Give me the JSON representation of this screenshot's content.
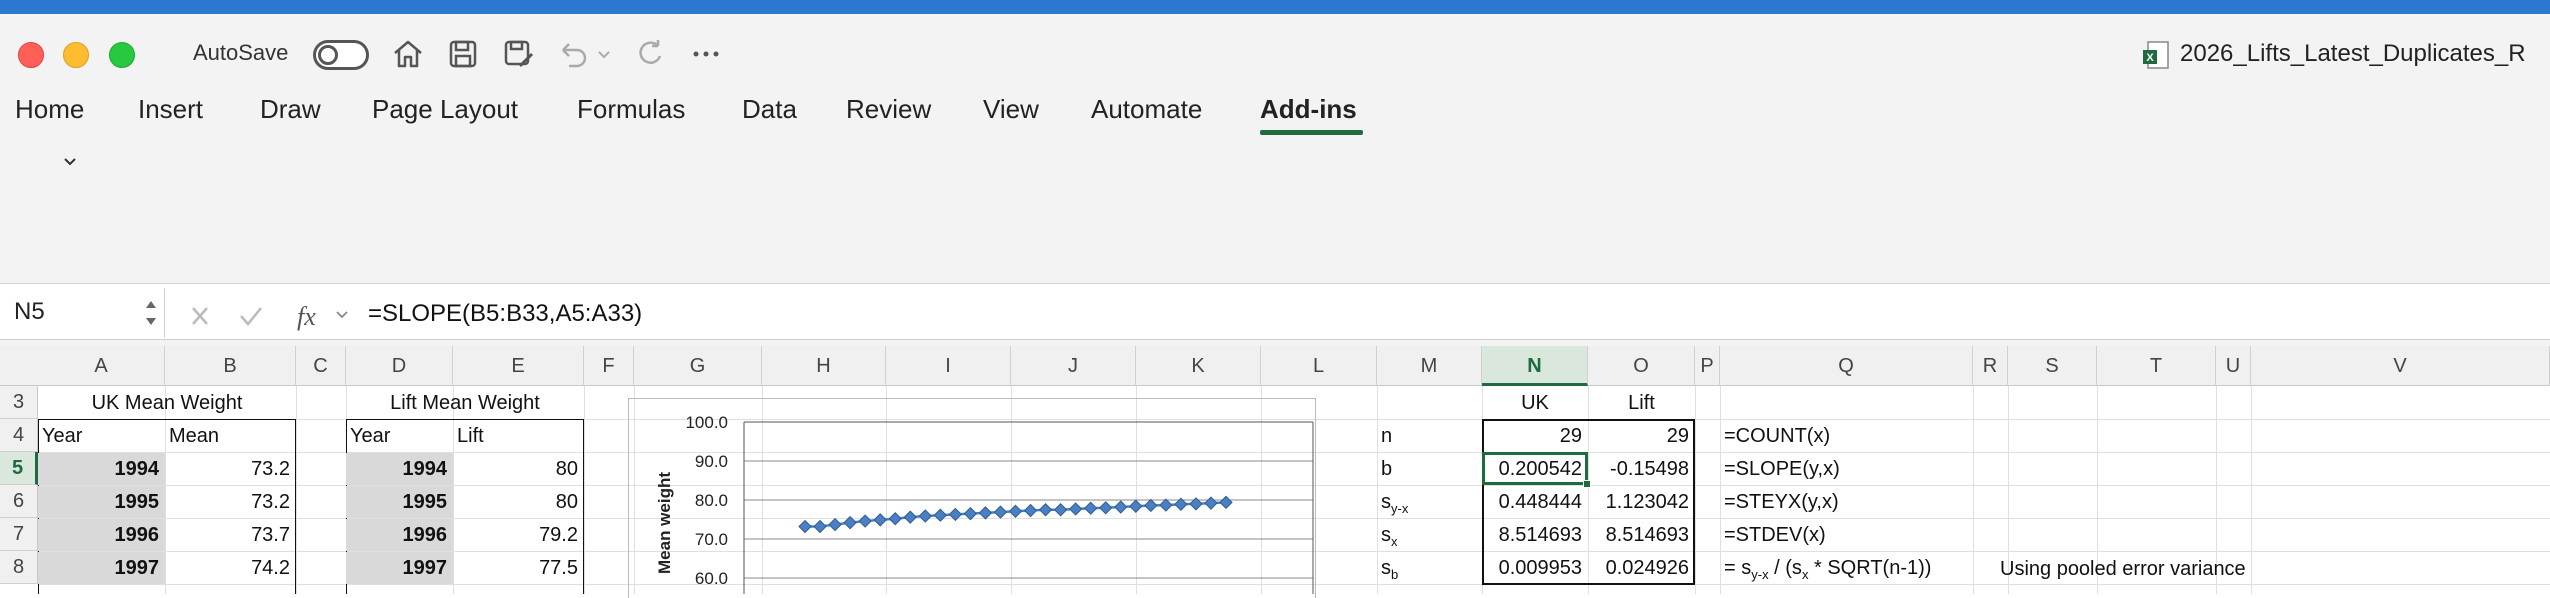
{
  "window": {
    "autosave_label": "AutoSave",
    "filename": "2026_Lifts_Latest_Duplicates_R"
  },
  "ribbon": {
    "tabs": [
      "Home",
      "Insert",
      "Draw",
      "Page Layout",
      "Formulas",
      "Data",
      "Review",
      "View",
      "Automate",
      "Add-ins"
    ],
    "active_tab": "Add-ins"
  },
  "formula_bar": {
    "name_box": "N5",
    "formula": "=SLOPE(B5:B33,A5:A33)"
  },
  "columns": [
    "A",
    "B",
    "C",
    "D",
    "E",
    "F",
    "G",
    "H",
    "I",
    "J",
    "K",
    "L",
    "M",
    "N",
    "O",
    "P",
    "Q",
    "R",
    "S",
    "T",
    "U",
    "V"
  ],
  "rows": [
    "3",
    "4",
    "5",
    "6",
    "7",
    "8"
  ],
  "uk_table": {
    "title": "UK Mean Weight",
    "headers": [
      "Year",
      "Mean"
    ],
    "rows": [
      [
        "1994",
        "73.2"
      ],
      [
        "1995",
        "73.2"
      ],
      [
        "1996",
        "73.7"
      ],
      [
        "1997",
        "74.2"
      ]
    ]
  },
  "lift_table": {
    "title": "Lift Mean Weight",
    "headers": [
      "Year",
      "Lift"
    ],
    "rows": [
      [
        "1994",
        "80"
      ],
      [
        "1995",
        "80"
      ],
      [
        "1996",
        "79.2"
      ],
      [
        "1997",
        "77.5"
      ]
    ]
  },
  "stats": {
    "col_headers": [
      "UK",
      "Lift"
    ],
    "rows": [
      {
        "label": "n",
        "label_sub": "",
        "uk": "29",
        "lift": "29",
        "formula": "=COUNT(x)"
      },
      {
        "label": "b",
        "label_sub": "",
        "uk": "0.200542",
        "lift": "-0.15498",
        "formula": "=SLOPE(y,x)"
      },
      {
        "label": "s",
        "label_sub": "y-x",
        "uk": "0.448444",
        "lift": "1.123042",
        "formula": "=STEYX(y,x)"
      },
      {
        "label": "s",
        "label_sub": "x",
        "uk": "8.514693",
        "lift": "8.514693",
        "formula": "=STDEV(x)"
      },
      {
        "label": "s",
        "label_sub": "b",
        "uk": "0.009953",
        "lift": "0.024926",
        "formula": "= s<sub>y-x</sub> / (s<sub>x</sub> * SQRT(n-1))"
      }
    ],
    "formula_sb_parts": [
      "= s",
      "y-x",
      " / (s",
      "x",
      " * SQRT(n-1))"
    ],
    "pooled_note": "Using pooled error variance"
  },
  "chart_data": {
    "type": "line",
    "title": "",
    "ylabel": "Mean weight",
    "xlabel": "",
    "yticks": [
      "100.0",
      "90.0",
      "80.0",
      "70.0",
      "60.0"
    ],
    "ylim": [
      60,
      100
    ],
    "series": [
      {
        "values": [
          73.2,
          73.2,
          73.7,
          74.2,
          74.6,
          74.9,
          75.2,
          75.6,
          75.9,
          76.1,
          76.3,
          76.5,
          76.7,
          76.9,
          77.1,
          77.3,
          77.5,
          77.5,
          77.7,
          77.9,
          78.0,
          78.2,
          78.4,
          78.6,
          78.7,
          78.9,
          79.0,
          79.2,
          79.4
        ]
      }
    ],
    "marker_color": "#4a7fc1",
    "grid": true
  }
}
